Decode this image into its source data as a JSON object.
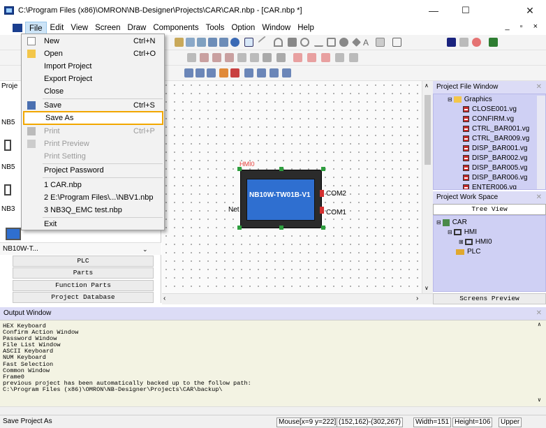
{
  "window": {
    "title": "C:\\Program Files (x86)\\OMRON\\NB-Designer\\Projects\\CAR\\CAR.nbp - [CAR.nbp *]",
    "minimize": "—",
    "maximize": "☐",
    "close": "✕"
  },
  "menubar": {
    "items": [
      "File",
      "Edit",
      "View",
      "Screen",
      "Draw",
      "Components",
      "Tools",
      "Option",
      "Window",
      "Help"
    ],
    "right_controls": "_ ▫ ×"
  },
  "file_menu": {
    "items": [
      {
        "label": "New",
        "shortcut": "Ctrl+N",
        "enabled": true
      },
      {
        "label": "Open",
        "shortcut": "Ctrl+O",
        "enabled": true
      },
      {
        "label": "Import Project",
        "shortcut": "",
        "enabled": true
      },
      {
        "label": "Export Project",
        "shortcut": "",
        "enabled": true
      },
      {
        "label": "Close",
        "shortcut": "",
        "enabled": true
      },
      {
        "label": "Save",
        "shortcut": "Ctrl+S",
        "enabled": true
      },
      {
        "label": "Save As",
        "shortcut": "",
        "enabled": true,
        "highlighted": true
      },
      {
        "label": "Print",
        "shortcut": "Ctrl+P",
        "enabled": false
      },
      {
        "label": "Print Preview",
        "shortcut": "",
        "enabled": false
      },
      {
        "label": "Print Setting",
        "shortcut": "",
        "enabled": false
      },
      {
        "label": "Project Password",
        "shortcut": "",
        "enabled": true
      },
      {
        "label": "1 CAR.nbp",
        "shortcut": "",
        "enabled": true
      },
      {
        "label": "2 E:\\Program Files\\...\\NBV1.nbp",
        "shortcut": "",
        "enabled": true
      },
      {
        "label": "3 NB3Q_EMC test.nbp",
        "shortcut": "",
        "enabled": true
      },
      {
        "label": "Exit",
        "shortcut": "",
        "enabled": true
      }
    ]
  },
  "left_panel": {
    "header": "Proje",
    "visible_labels": [
      "NB5",
      "NB5",
      "NB3"
    ],
    "selected_model": "NB10W-T...",
    "buttons": [
      "PLC",
      "Parts",
      "Function Parts",
      "Project Database"
    ]
  },
  "canvas": {
    "hmi_label": "HMI0",
    "device_text": "NB10W-TW01B-V1",
    "net_label": "Net",
    "com2": "COM2",
    "com1": "COM1"
  },
  "project_file_window": {
    "title": "Project File Window",
    "folder": "Graphics",
    "files": [
      "CLOSE001.vg",
      "CONFIRM.vg",
      "CTRL_BAR001.vg",
      "CTRL_BAR009.vg",
      "DISP_BAR001.vg",
      "DISP_BAR002.vg",
      "DISP_BAR005.vg",
      "DISP_BAR006.vg",
      "ENTER006.vg"
    ]
  },
  "project_work_space": {
    "title": "Project Work Space",
    "tab": "Tree View",
    "tree": [
      "CAR",
      "HMI",
      "HMI0",
      "PLC"
    ],
    "bottom_tab": "Screens Preview"
  },
  "output_window": {
    "title": "Output Window",
    "lines": [
      "HEX Keyboard",
      "Confirm Action Window",
      "Password Window",
      "File List Window",
      "ASCII Keyboard",
      "NUM Keyboard",
      "Fast Selection",
      "Common Window",
      "Frame0",
      "previous project has been automatically backed up to the follow path:",
      "C:\\Program Files (x86)\\OMRON\\NB-Designer\\Projects\\CAR\\backup\\"
    ]
  },
  "statusbar": {
    "message": "Save Project As",
    "mouse": "Mouse[x=9  y=222]",
    "range": "(152,162)-(302,267)",
    "width": "Width=151",
    "height": "Height=106",
    "mode": "Upper"
  },
  "colors": {
    "panel_header": "#dcdcf6",
    "panel_body": "#cfd0f4",
    "output_bg": "#f3f3e3",
    "highlight_border": "#f2a700",
    "device_screen": "#2f6fd0"
  }
}
